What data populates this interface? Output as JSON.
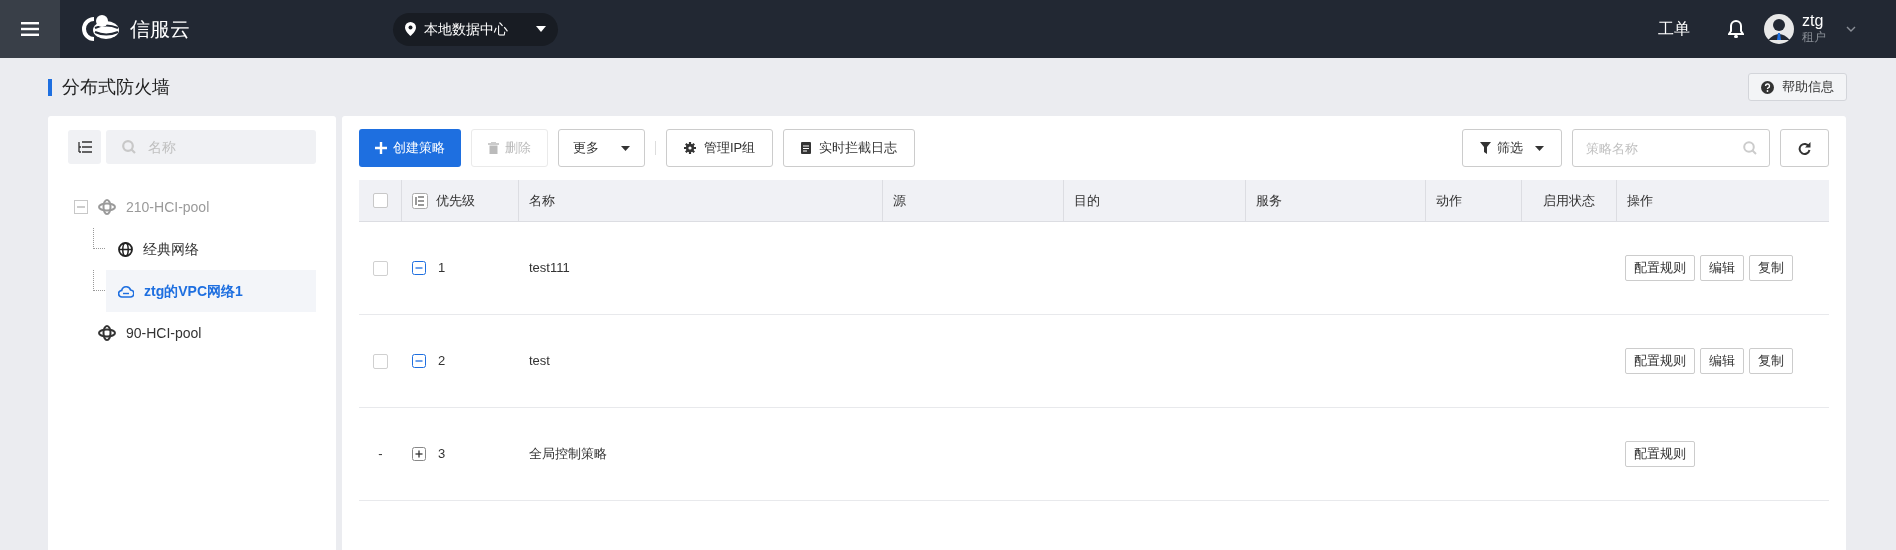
{
  "topbar": {
    "brand": "信服云",
    "location": "本地数据中心",
    "ticket": "工单",
    "user": {
      "name": "ztg",
      "role": "租户"
    }
  },
  "page": {
    "title": "分布式防火墙",
    "help": "帮助信息"
  },
  "tree": {
    "search_placeholder": "名称",
    "items": [
      {
        "label": "210-HCI-pool",
        "kind": "pool",
        "expanded": true,
        "disabled": true,
        "selected": false,
        "children": [
          {
            "label": "经典网络",
            "kind": "classic",
            "selected": false
          },
          {
            "label": "ztg的VPC网络1",
            "kind": "vpc",
            "selected": true
          }
        ]
      },
      {
        "label": "90-HCI-pool",
        "kind": "pool",
        "disabled": false,
        "selected": false
      }
    ]
  },
  "toolbar": {
    "create": "创建策略",
    "delete": {
      "label": "删除",
      "disabled": true
    },
    "more": "更多",
    "ip_group": "管理IP组",
    "log": "实时拦截日志",
    "filter": "筛选",
    "search_placeholder": "策略名称"
  },
  "table": {
    "select_all": {
      "checked": false
    },
    "columns": [
      "优先级",
      "名称",
      "源",
      "目的",
      "服务",
      "动作",
      "启用状态",
      "操作"
    ],
    "rows": [
      {
        "kind": "policy",
        "checked": false,
        "expanded": true,
        "priority": "1",
        "name": "test111",
        "actions": [
          "配置规则",
          "编辑",
          "复制"
        ]
      },
      {
        "kind": "policy",
        "checked": false,
        "expanded": true,
        "priority": "2",
        "name": "test",
        "actions": [
          "配置规则",
          "编辑",
          "复制"
        ]
      },
      {
        "kind": "global",
        "select_text": "-",
        "expanded": false,
        "priority": "3",
        "name": "全局控制策略",
        "actions": [
          "配置规则"
        ]
      }
    ]
  }
}
